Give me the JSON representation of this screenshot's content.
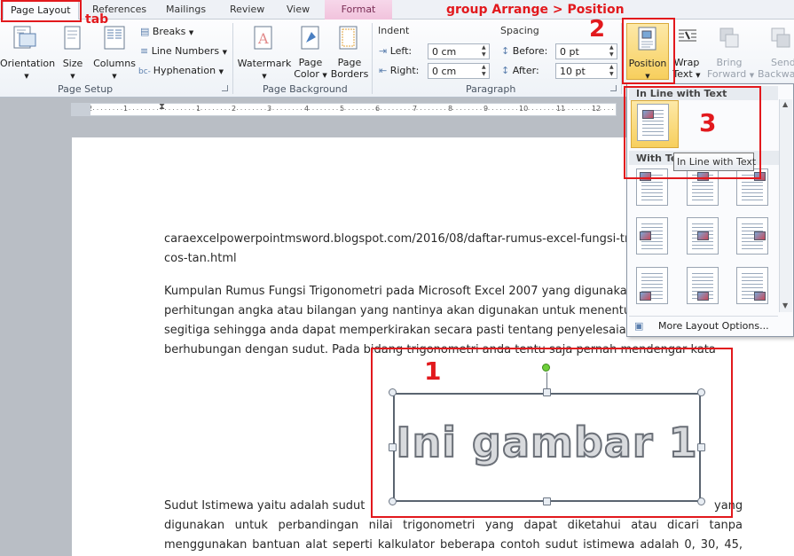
{
  "tabs": {
    "page_layout": "Page Layout",
    "references": "References",
    "mailings": "Mailings",
    "review": "Review",
    "view": "View",
    "format": "Format"
  },
  "annotations": {
    "tab_note": "tab",
    "group_note": "group Arrange > Position",
    "num1": "1",
    "num2": "2",
    "num3": "3"
  },
  "page_setup": {
    "orientation": "Orientation",
    "size": "Size",
    "columns": "Columns",
    "breaks": "Breaks",
    "line_numbers": "Line Numbers",
    "hyphenation": "Hyphenation",
    "group": "Page Setup"
  },
  "page_background": {
    "watermark": "Watermark",
    "page_color_1": "Page",
    "page_color_2": "Color",
    "page_borders_1": "Page",
    "page_borders_2": "Borders",
    "group": "Page Background"
  },
  "paragraph": {
    "indent": "Indent",
    "left_label": "Left:",
    "left_value": "0 cm",
    "right_label": "Right:",
    "right_value": "0 cm",
    "spacing": "Spacing",
    "before_label": "Before:",
    "before_value": "0 pt",
    "after_label": "After:",
    "after_value": "10 pt",
    "group": "Paragraph"
  },
  "arrange": {
    "position": "Position",
    "wrap_1": "Wrap",
    "wrap_2": "Text",
    "bring_1": "Bring",
    "bring_2": "Forward",
    "send_1": "Send",
    "send_2": "Backward"
  },
  "dropdown": {
    "inline_header": "In Line with Text",
    "with_text_header": "With Text Wrapping",
    "tooltip": "In Line with Text",
    "more": "More Layout Options..."
  },
  "ruler": {
    "marks": [
      "2",
      "1",
      "1",
      "2",
      "3",
      "4",
      "5",
      "6",
      "7",
      "8",
      "9",
      "10",
      "11",
      "12",
      "13",
      "14",
      "15"
    ]
  },
  "doc": {
    "url_line1": "caraexcelpowerpointmsword.blogspot.com/2016/08/daftar-rumus-excel-fungsi-trigonometri-sin-",
    "url_line2": "cos-tan.html",
    "p1_l1": "Kumpulan Rumus Fungsi Trigonometri pada Microsoft Excel 2007 yang digunakan untuk",
    "p1_l2": "perhitungan angka atau bilangan yang nantinya akan digunakan untuk menentukan sudut",
    "p1_l3": "segitiga sehingga anda dapat memperkirakan secara pasti tentang penyelesaian masalah yang",
    "p1_l4": "berhubungan dengan sudut. Pada bidang trigonometri anda tentu saja pernah mendengar kata",
    "image_text": "Ini gambar 1",
    "p2_l1a": "Sudut Istimewa yaitu adalah sudut",
    "p2_l1b": "yang",
    "p2_l2": "digunakan untuk perbandingan nilai trigonometri yang dapat diketahui atau dicari tanpa",
    "p2_l3": "menggunakan bantuan alat seperti kalkulator beberapa contoh sudut istimewa adalah 0, 30, 45, 60,"
  }
}
